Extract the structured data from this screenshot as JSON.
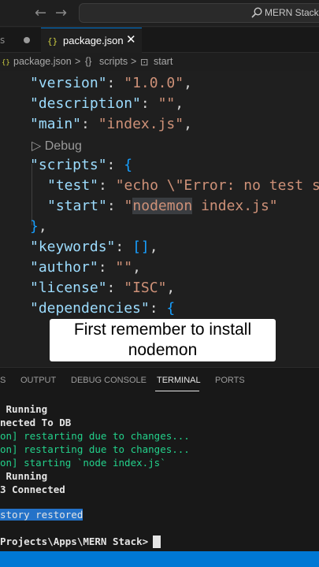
{
  "titlebar": {
    "nav_back": "←",
    "nav_forward": "→",
    "search_text": "MERN Stack"
  },
  "tabs": {
    "previous_label": "s",
    "active_label": "package.json",
    "close_glyph": "✕"
  },
  "breadcrumb": {
    "file": "package.json",
    "separator": ">",
    "scripts_icon": "{}",
    "scripts": "scripts",
    "start_icon": "⊡",
    "start": "start"
  },
  "editor": {
    "codelens": "▷ Debug",
    "lines": [
      {
        "key": "\"version\"",
        "value": "\"1.0.0\"",
        "tail": ","
      },
      {
        "key": "\"description\"",
        "value": "\"\"",
        "tail": ","
      },
      {
        "key": "\"main\"",
        "value": "\"index.js\"",
        "tail": ","
      },
      {
        "key": "\"scripts\"",
        "open": "{"
      },
      {
        "key": "\"test\"",
        "value": "\"echo \\\"Error: no test s"
      },
      {
        "key": "\"start\"",
        "value_pre": "\"",
        "value_hl": "nodemon",
        "value_post": " index.js\""
      },
      {
        "close": "}",
        "tail": ","
      },
      {
        "key": "\"keywords\"",
        "value": "[]",
        "tail": ","
      },
      {
        "key": "\"author\"",
        "value": "\"\"",
        "tail": ","
      },
      {
        "key": "\"license\"",
        "value": "\"ISC\"",
        "tail": ","
      },
      {
        "key": "\"dependencies\"",
        "open": "{"
      }
    ]
  },
  "caption": {
    "line1": "First remember to install",
    "line2": "nodemon"
  },
  "panel": {
    "tabs": [
      "S",
      "OUTPUT",
      "DEBUG CONSOLE",
      "TERMINAL",
      "PORTS"
    ],
    "active_tab": "TERMINAL",
    "terminal_lines": [
      {
        "text": " Running",
        "style": "white"
      },
      {
        "text": "nected To DB",
        "style": "white"
      },
      {
        "text": "on] restarting due to changes...",
        "style": "green"
      },
      {
        "text": "on] restarting due to changes...",
        "style": "green"
      },
      {
        "text": "on] starting `node index.js`",
        "style": "green"
      },
      {
        "text": " Running",
        "style": "white"
      },
      {
        "text": "3 Connected",
        "style": "white"
      }
    ],
    "history_restored": "story restored",
    "prompt": "Projects\\Apps\\MERN Stack> "
  },
  "colors": {
    "accent": "#0078d4",
    "editor_bg": "#1f1f1f",
    "key": "#9cdcfe",
    "string": "#ce9178",
    "terminal_green": "#23d18b"
  }
}
